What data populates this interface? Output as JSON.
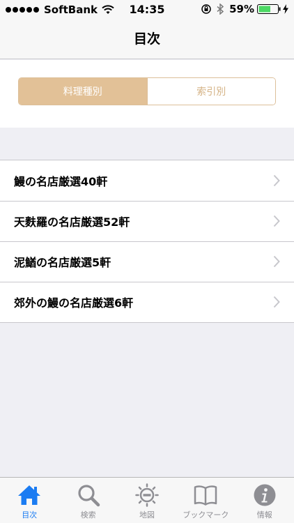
{
  "status_bar": {
    "carrier": "SoftBank",
    "time": "14:35",
    "battery_percent": "59%",
    "signal_bars": 5
  },
  "nav": {
    "title": "目次"
  },
  "segment": {
    "options": [
      "料理種別",
      "索引別"
    ],
    "selected": 0
  },
  "list": {
    "items": [
      {
        "label": "鰻の名店厳選40軒"
      },
      {
        "label": "天麩羅の名店厳選52軒"
      },
      {
        "label": "泥鰌の名店厳選5軒"
      },
      {
        "label": "郊外の鰻の名店厳選6軒"
      }
    ]
  },
  "tab_bar": {
    "tabs": [
      {
        "label": "目次",
        "icon": "home-icon",
        "active": true
      },
      {
        "label": "検索",
        "icon": "search-icon",
        "active": false
      },
      {
        "label": "地図",
        "icon": "map-icon",
        "active": false
      },
      {
        "label": "ブックマーク",
        "icon": "book-icon",
        "active": false
      },
      {
        "label": "情報",
        "icon": "info-icon",
        "active": false
      }
    ]
  },
  "colors": {
    "accent": "#e2c197",
    "tab_active": "#1b7cf2",
    "tab_inactive": "#8e8e93"
  }
}
